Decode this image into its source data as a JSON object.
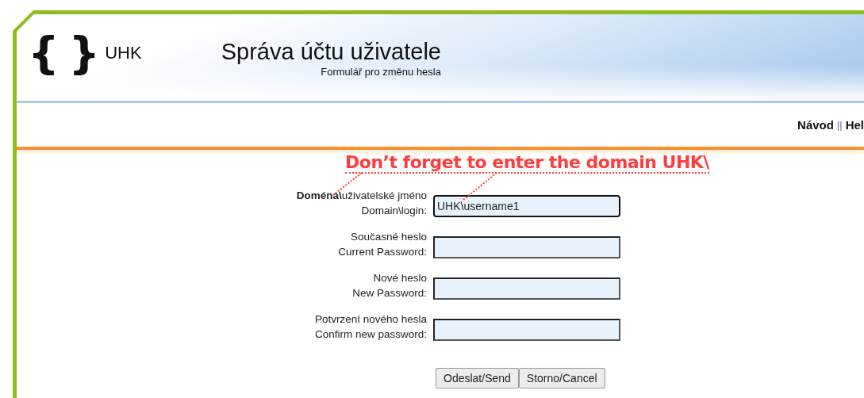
{
  "header": {
    "logo_mark": "{ }",
    "logo_text": "UHK",
    "title": "Správa účtu uživatele",
    "subtitle": "Formulář pro změnu hesla"
  },
  "nav": {
    "links": [
      {
        "label": "Návod"
      },
      {
        "label": "Hel"
      }
    ],
    "separator": "||"
  },
  "annotation": {
    "text": "Don’t forget to enter the domain UHK\\"
  },
  "form": {
    "fields": [
      {
        "label": "**Doména\\**uživatelské jméno",
        "label_en": "Domain\\login:",
        "value": "UHK\\username1",
        "focused": true
      },
      {
        "label": "Současné heslo",
        "label_en": "Current Password:",
        "focused": false
      },
      {
        "label": "Nové heslo",
        "label_en": "New Password:",
        "focused": false
      },
      {
        "label": "Potvrzení nového hesla",
        "label_en": "Confirm new password:",
        "focused": false
      }
    ],
    "buttons": [
      {
        "label": "Odeslat/Send"
      },
      {
        "label": "Storno/Cancel"
      }
    ]
  }
}
